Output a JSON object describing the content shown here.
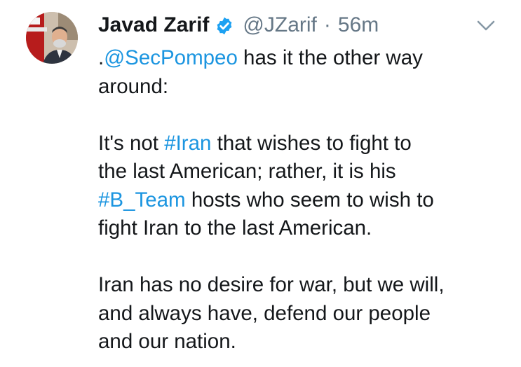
{
  "tweet": {
    "author": {
      "display_name": "Javad Zarif",
      "handle": "@JZarif",
      "timestamp": "56m",
      "separator": "·",
      "verified": true,
      "verified_icon": "verified-badge-icon",
      "avatar": "avatar-photo"
    },
    "menu_icon": "chevron-down-icon",
    "paragraphs": [
      {
        "lines": [
          [
            {
              "t": "."
            },
            {
              "t": "@SecPompeo",
              "link": true
            },
            {
              "t": " has it the other way"
            }
          ],
          [
            {
              "t": "around:"
            }
          ]
        ]
      },
      {
        "lines": [
          [
            {
              "t": "It's not "
            },
            {
              "t": "#Iran",
              "link": true
            },
            {
              "t": " that wishes to fight to"
            }
          ],
          [
            {
              "t": "the last American; rather, it is his"
            }
          ],
          [
            {
              "t": "#B_Team",
              "link": true
            },
            {
              "t": " hosts who seem to wish to"
            }
          ],
          [
            {
              "t": "fight Iran to the last American."
            }
          ]
        ]
      },
      {
        "lines": [
          [
            {
              "t": "Iran has no desire for war, but we will,"
            }
          ],
          [
            {
              "t": "and always have, defend our people"
            }
          ],
          [
            {
              "t": "and our nation."
            }
          ]
        ]
      }
    ]
  },
  "colors": {
    "text": "#14171a",
    "secondary": "#657786",
    "link": "#1b95e0",
    "verified": "#1da1f2",
    "background": "#ffffff"
  }
}
